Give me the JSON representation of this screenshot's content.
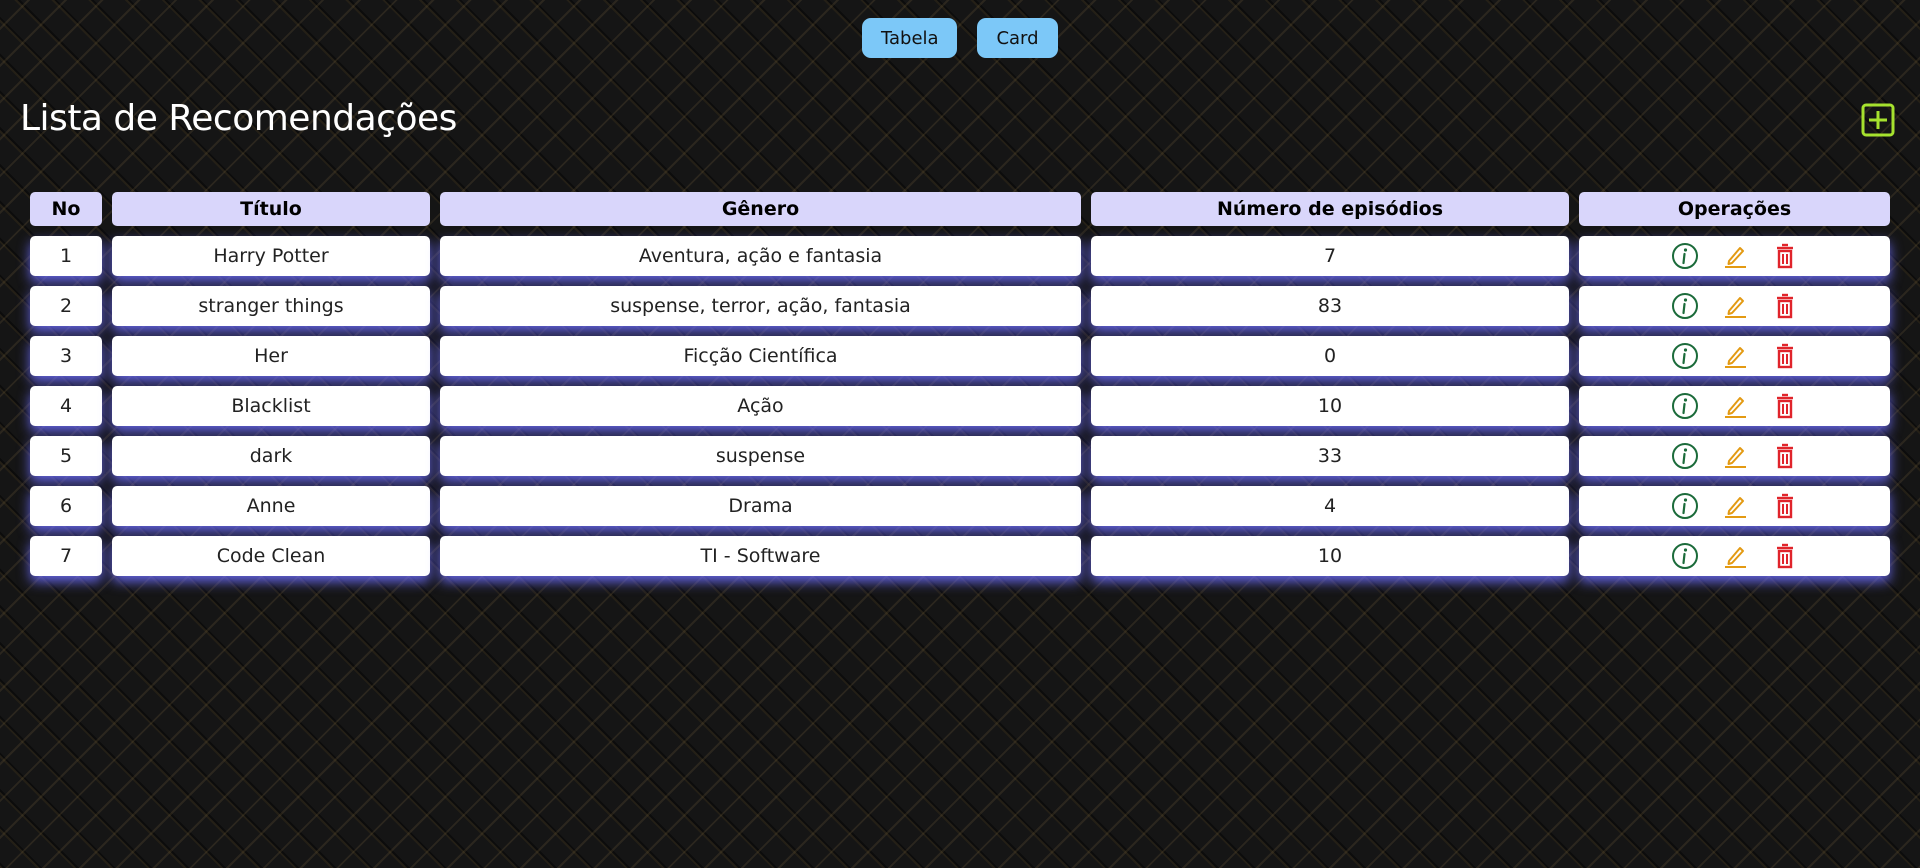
{
  "view_toggle": {
    "tabela_label": "Tabela",
    "card_label": "Card"
  },
  "page": {
    "title": "Lista de Recomendações"
  },
  "icons": {
    "add": "plus-square-icon",
    "info": "info-circle-icon",
    "edit": "pencil-icon",
    "delete": "trash-icon"
  },
  "colors": {
    "toggle_button": "#7cc8f8",
    "add_icon": "#a6e22e",
    "info_icon": "#1b6b3a",
    "edit_icon": "#e39a12",
    "delete_icon": "#e0242b",
    "header_cell": "#d9d6fb",
    "row_glow": "#6e6eff"
  },
  "table": {
    "headers": [
      "No",
      "Título",
      "Gênero",
      "Número de episódios",
      "Operações"
    ],
    "rows": [
      {
        "no": "1",
        "titulo": "Harry Potter",
        "genero": "Aventura, ação e fantasia",
        "episodios": "7"
      },
      {
        "no": "2",
        "titulo": "stranger things",
        "genero": "suspense, terror, ação, fantasia",
        "episodios": "83"
      },
      {
        "no": "3",
        "titulo": "Her",
        "genero": "Ficção Científica",
        "episodios": "0"
      },
      {
        "no": "4",
        "titulo": "Blacklist",
        "genero": "Ação",
        "episodios": "10"
      },
      {
        "no": "5",
        "titulo": "dark",
        "genero": "suspense",
        "episodios": "33"
      },
      {
        "no": "6",
        "titulo": "Anne",
        "genero": "Drama",
        "episodios": "4"
      },
      {
        "no": "7",
        "titulo": "Code Clean",
        "genero": "TI - Software",
        "episodios": "10"
      }
    ]
  }
}
